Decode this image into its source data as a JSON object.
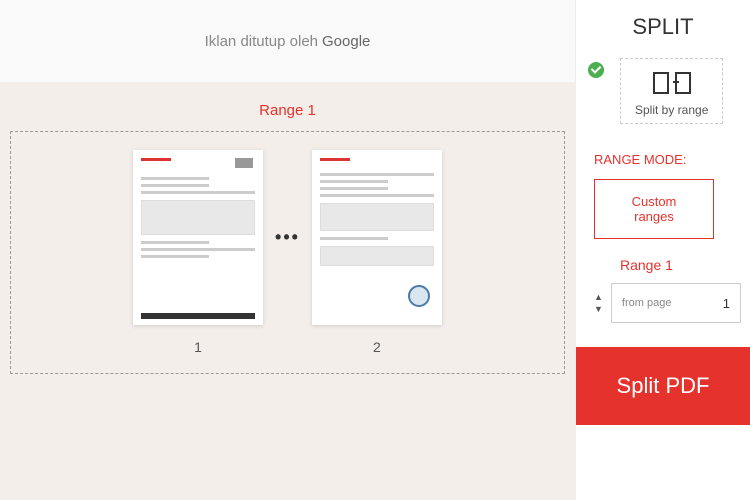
{
  "ad": {
    "text": "Iklan ditutup oleh",
    "brand": "Google"
  },
  "preview": {
    "range_title": "Range 1",
    "pages": [
      {
        "num": "1"
      },
      {
        "num": "2"
      }
    ],
    "ellipsis": "•••"
  },
  "panel": {
    "title": "SPLIT",
    "mode_option_label": "Split by range",
    "range_mode_label": "RANGE MODE:",
    "custom_ranges_btn": "Custom\nranges",
    "range_config": {
      "title": "Range 1",
      "from_label": "from page",
      "from_value": "1"
    },
    "action": "Split PDF"
  }
}
